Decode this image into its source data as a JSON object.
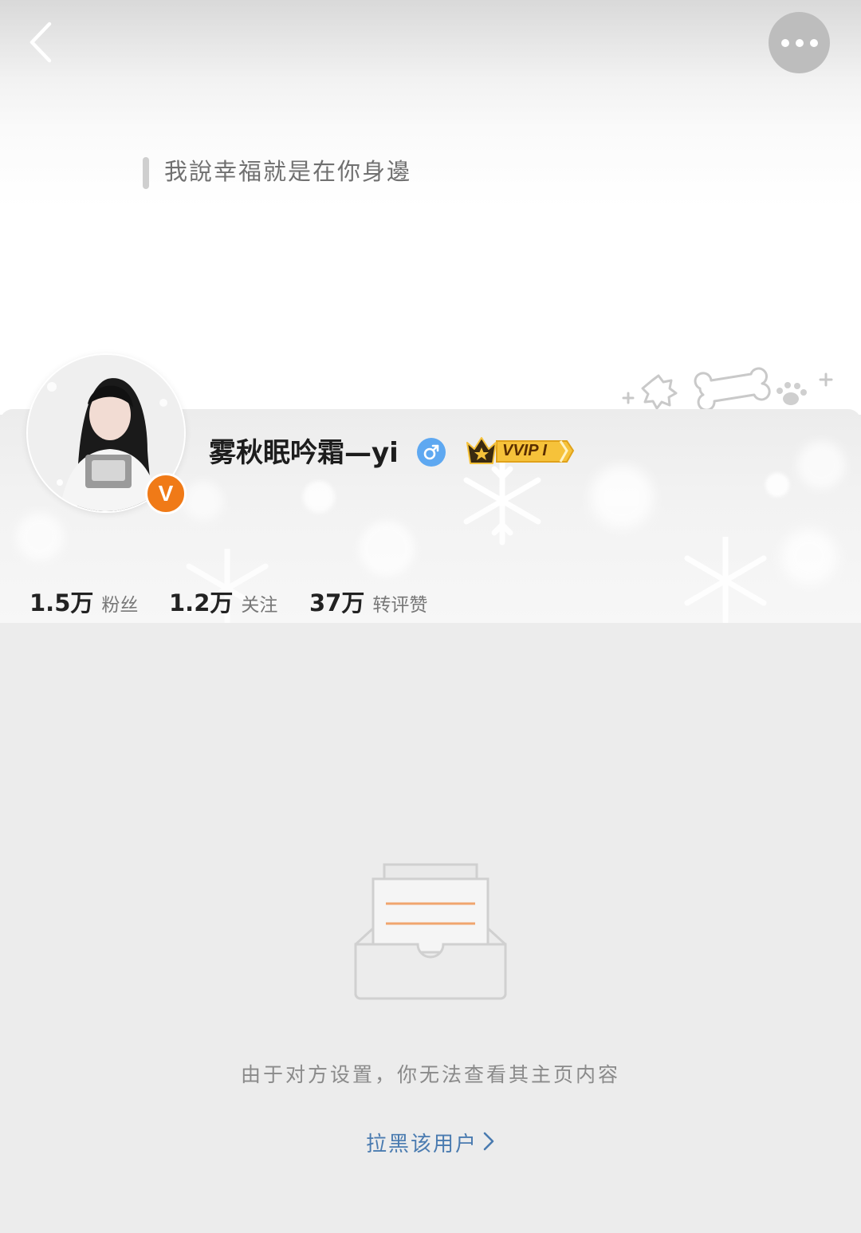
{
  "header": {
    "back_icon": "chevron-left-icon",
    "more_icon": "more-dots-icon"
  },
  "profile": {
    "bio": "我說幸福就是在你身邊",
    "username": "雾秋眠吟霜—yi",
    "gender_icon": "male-icon",
    "verified_badge": "V",
    "vip_badge": "VVIP I"
  },
  "stats": [
    {
      "value": "1.5万",
      "label": "粉丝"
    },
    {
      "value": "1.2万",
      "label": "关注"
    },
    {
      "value": "37万",
      "label": "转评赞"
    }
  ],
  "empty_state": {
    "icon": "empty-inbox-icon",
    "message": "由于对方设置，你无法查看其主页内容",
    "block_link": "拉黑该用户"
  },
  "colors": {
    "accent_orange": "#f07a17",
    "link_blue": "#4a7bb0",
    "gender_blue": "#5ea8f1",
    "vip_gold": "#f6c23a"
  }
}
